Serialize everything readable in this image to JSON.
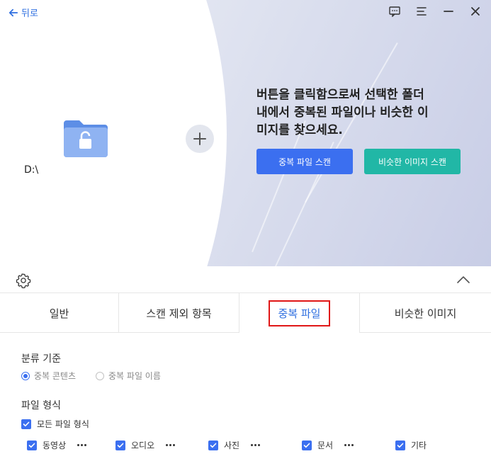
{
  "header": {
    "back_label": "뒤로"
  },
  "source": {
    "drive_label": "D:\\"
  },
  "instruction": {
    "line1": "버튼을 클릭함으로써 선택한 폴더",
    "line2": "내에서 중복된 파일이나 비슷한 이",
    "line3": "미지를 찾으세요."
  },
  "actions": {
    "scan_duplicates": "중복 파일 스캔",
    "scan_similar": "비슷한 이미지 스캔"
  },
  "tabs": [
    {
      "label": "일반"
    },
    {
      "label": "스캔 제외 항목"
    },
    {
      "label": "중복 파일"
    },
    {
      "label": "비슷한 이미지"
    }
  ],
  "active_tab": "중복 파일",
  "criteria": {
    "title": "분류 기준",
    "options": [
      {
        "label": "중복 콘텐츠",
        "selected": true
      },
      {
        "label": "중복 파일 이름",
        "selected": false
      }
    ]
  },
  "file_types": {
    "title": "파일 형식",
    "all_label": "모든 파일 형식",
    "items": [
      {
        "label": "동영상",
        "checked": true
      },
      {
        "label": "오디오",
        "checked": true
      },
      {
        "label": "사진",
        "checked": true
      },
      {
        "label": "문서",
        "checked": true
      },
      {
        "label": "기타",
        "checked": true
      }
    ]
  },
  "colors": {
    "accent": "#3b6ff0",
    "teal": "#21b7a6",
    "highlight": "#e01616"
  }
}
